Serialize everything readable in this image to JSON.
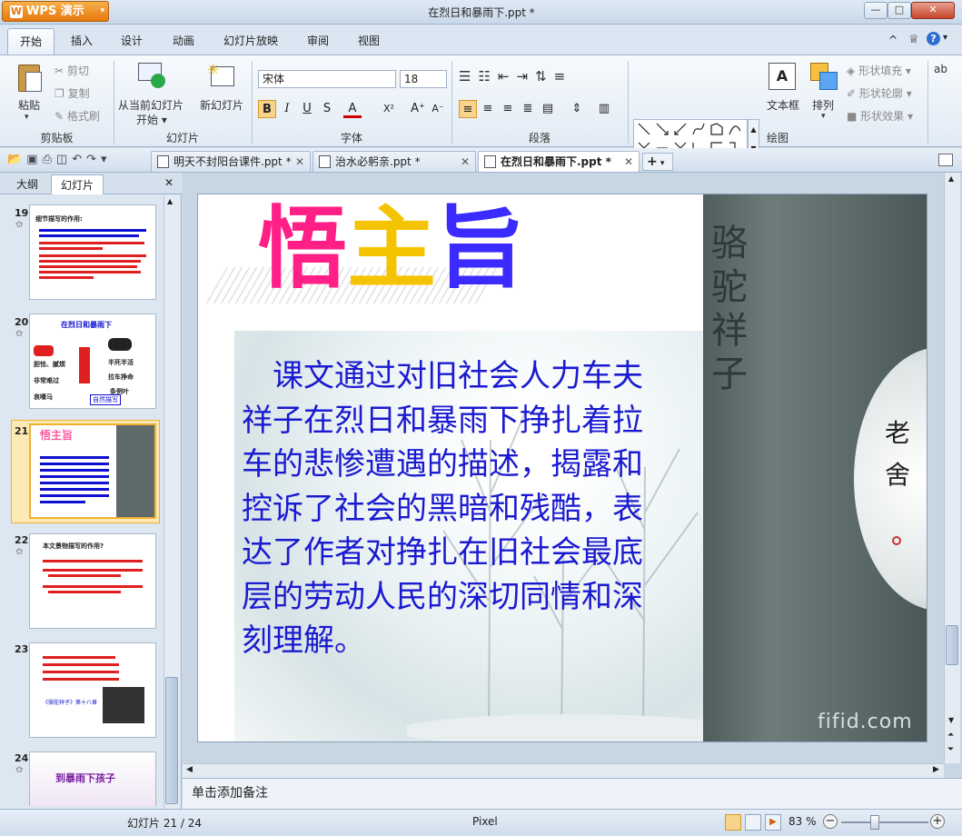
{
  "app": {
    "button_label": "WPS 演示",
    "window_title": "在烈日和暴雨下.ppt *"
  },
  "window_buttons": {
    "minimize": "—",
    "maximize": "□",
    "close": "✕"
  },
  "menu": {
    "tabs": [
      "开始",
      "插入",
      "设计",
      "动画",
      "幻灯片放映",
      "审阅",
      "视图"
    ],
    "active": "开始"
  },
  "ribbon": {
    "clipboard": {
      "paste": "粘贴",
      "cut": "剪切",
      "copy": "复制",
      "format_painter": "格式刷",
      "group": "剪贴板"
    },
    "slides": {
      "from_current": "从当前幻灯片",
      "start": "开始",
      "new_slide": "新幻灯片",
      "group": "幻灯片"
    },
    "font": {
      "name": "宋体",
      "size": "18",
      "bold": "B",
      "italic": "I",
      "underline": "U",
      "shadow": "S",
      "color": "A",
      "superscript": "X²",
      "grow": "A⁺",
      "shrink": "A⁻",
      "group": "字体"
    },
    "paragraph": {
      "group": "段落"
    },
    "drawing": {
      "textbox": "文本框",
      "arrange": "排列",
      "shape_fill": "形状填充",
      "shape_outline": "形状轮廓",
      "shape_effect": "形状效果",
      "group": "绘图"
    }
  },
  "doc_tabs": [
    {
      "label": "明天不封阳台课件.ppt *",
      "active": false
    },
    {
      "label": "治水必躬亲.ppt *",
      "active": false
    },
    {
      "label": "在烈日和暴雨下.ppt *",
      "active": true
    }
  ],
  "left_panel": {
    "tabs": [
      "大纲",
      "幻灯片"
    ],
    "active": "幻灯片",
    "close": "✕",
    "thumbnails": [
      {
        "num": "19",
        "title": "细节描写的作用:"
      },
      {
        "num": "20",
        "title": "在烈日和暴雨下",
        "w1": "胆怯、腻烦",
        "w2": "非常难过",
        "w3": "哀嚎马",
        "w4": "半死半活",
        "w5": "拉车挣命",
        "w6": "条例叶",
        "label": "自然描写"
      },
      {
        "num": "21",
        "title": "悟主旨",
        "selected": true
      },
      {
        "num": "22",
        "title": "本文景物描写的作用?"
      },
      {
        "num": "23",
        "caption": "《骆驼祥子》第十八章"
      },
      {
        "num": "24",
        "title": "到暴雨下孩子"
      }
    ]
  },
  "slide": {
    "title_chars": [
      "悟",
      "主",
      "旨"
    ],
    "body": "　课文通过对旧社会人力车夫祥子在烈日和暴雨下挣扎着拉车的悲惨遭遇的描述，揭露和控诉了社会的黑暗和残酷，表达了作者对挣扎在旧社会最底层的劳动人民的深切同情和深刻理解。",
    "cover_title": "骆驼祥子",
    "cover_author": "老舍",
    "watermark": "fifid.com"
  },
  "notes": {
    "placeholder": "单击添加备注"
  },
  "status": {
    "slide_counter": "幻灯片 21 / 24",
    "theme": "Pixel",
    "zoom": "83 %"
  },
  "colors": {
    "accent": "#2a3fd0",
    "title_gradient": [
      "#ff2a8a",
      "#ffcc00",
      "#00b050",
      "#2040ff",
      "#8a2be2"
    ],
    "slide_text": "#1a1ad0"
  }
}
